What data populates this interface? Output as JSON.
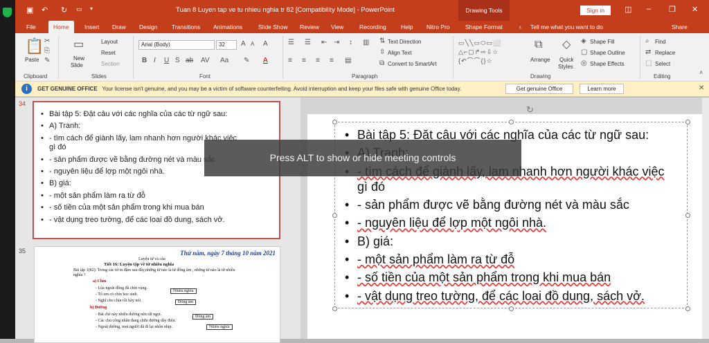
{
  "titlebar": {
    "title": "Tuan 8 Luyen tap ve tu nhieu nghia tr 82 [Compatibility Mode]  -  PowerPoint",
    "context_tab": "Drawing Tools",
    "sign_in": "Sign in"
  },
  "tabs": [
    "File",
    "Home",
    "Insert",
    "Draw",
    "Design",
    "Transitions",
    "Animations",
    "Slide Show",
    "Review",
    "View",
    "Recording",
    "Help",
    "Nitro Pro",
    "Shape Format"
  ],
  "tell_me": "Tell me what you want to do",
  "share": "Share",
  "ribbon": {
    "clipboard": {
      "paste": "Paste",
      "label": "Clipboard"
    },
    "slides": {
      "new_slide": "New",
      "new_slide2": "Slide",
      "layout": "Layout",
      "reset": "Reset",
      "section": "Section",
      "label": "Slides"
    },
    "font": {
      "family": "Arial (Body)",
      "size": "32",
      "label": "Font"
    },
    "paragraph": {
      "text_direction": "Text Direction",
      "align_text": "Align Text",
      "smartart": "Convert to SmartArt",
      "label": "Paragraph"
    },
    "drawing": {
      "arrange": "Arrange",
      "quick": "Quick",
      "styles": "Styles",
      "fill": "Shape Fill",
      "outline": "Shape Outline",
      "effects": "Shape Effects",
      "label": "Drawing"
    },
    "editing": {
      "find": "Find",
      "replace": "Replace",
      "select": "Select",
      "label": "Editing"
    }
  },
  "notice": {
    "title": "GET GENUINE OFFICE",
    "text": "Your license isn't genuine, and you may be a victim of software counterfeiting. Avoid interruption and keep your files safe with genuine Office today.",
    "btn1": "Get genuine Office",
    "btn2": "Learn more"
  },
  "thumbs": {
    "num1": "34",
    "num2": "35",
    "lines": [
      "Bài tập 5: Đặt câu với các nghĩa của các từ ngữ sau:",
      "A) Tranh:",
      "- tìm cách để giành lấy, lam nhanh hơn người khác việc",
      "gì đó",
      "-  sản phẩm được vẽ bằng đường nét và màu sắc",
      "- nguyên liệu để lợp một ngôi nhà.",
      "B) giá:",
      "- một sản phẩm làm ra từ đỗ",
      "- số tiền của một sản phẩm trong khi mua bán",
      "- vật dụng treo tường, để các loai đồ dung, sách vở."
    ],
    "s2_date": "Thứ năm, ngày 7 tháng 10 năm 2021",
    "s2_sub": "Luyện từ và câu",
    "s2_title": "Tiết 16:   Luyện tập về từ nhiều nghĩa",
    "s2_ex": "Bài tập 1(82): Trong các từ in đậm sau đây,những từ nào là từ đồng âm , những từ nào là từ nhiều nghĩa ?",
    "s2_a": "a) Chín",
    "s2_a1": "- Lúa ngoài đồng đã chín vàng.",
    "s2_a2": "- Tổ em có chín học sinh.",
    "s2_a3": "- Nghĩ cho chín rồi hãy nói.",
    "s2_b": "b) Đường",
    "s2_b1": "- Bát chè này nhiều đường nên rất ngọt.",
    "s2_b2": "- Các chú công nhân đang chữa đường dây điện.",
    "s2_b3": "- Ngoài đường, mọi người đã đi lại nhộn nhịp.",
    "box1": "Nhiều nghĩa",
    "box2": "Đồng âm",
    "box3": "Đồng âm",
    "box4": "Nhiều nghĩa"
  },
  "main": {
    "lines": [
      "Bài tập 5: Đặt câu với các nghĩa của các từ ngữ sau:",
      "A) Tranh:",
      "- tìm cách để giành lấy, lam nhanh hơn người khác việc",
      "gì đó",
      "-  sản phẩm được vẽ bằng đường nét và màu sắc",
      "- nguyên liệu để lợp một ngôi nhà.",
      "B) giá:",
      "- một sản phẩm làm ra từ đỗ",
      "- số tiền của một sản phẩm trong khi mua bán",
      "- vật dụng treo tường, để các loai đồ dung, sách vở."
    ]
  },
  "overlay": "Press ALT to show or hide meeting controls"
}
